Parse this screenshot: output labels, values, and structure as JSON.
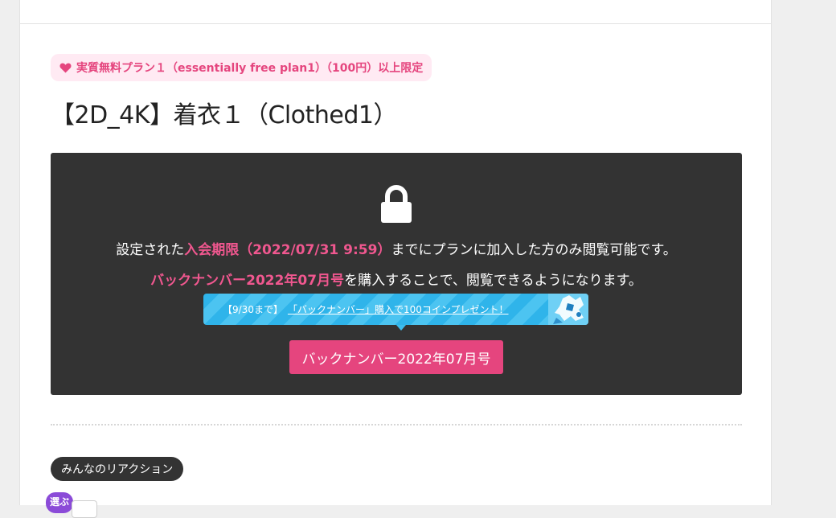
{
  "post": {
    "plan_badge": "実質無料プラン１（essentially free plan1）（100円）以上限定",
    "title": "【2D_4K】着衣１（Clothed1）"
  },
  "locked": {
    "line1_pre": "設定された",
    "line1_highlight": "入会期限（2022/07/31 9:59）",
    "line1_post": "までにプランに加入した方のみ閲覧可能です。",
    "line2_highlight": "バックナンバー2022年07月号",
    "line2_post": "を購入することで、閲覧できるようになります。",
    "promo_prefix": "【9/30まで】",
    "promo_link": "「バックナンバー」購入で100コインプレゼント！",
    "buy_button": "バックナンバー2022年07月号"
  },
  "reactions": {
    "label": "みんなのリアクション",
    "select_badge": "選ぶ"
  },
  "colors": {
    "accent_pink": "#e5457e",
    "dark_panel": "#333333",
    "promo_blue": "#2fb4ea",
    "select_purple": "#8b4bd8"
  },
  "icons": [
    "heart-icon",
    "lock-icon"
  ]
}
